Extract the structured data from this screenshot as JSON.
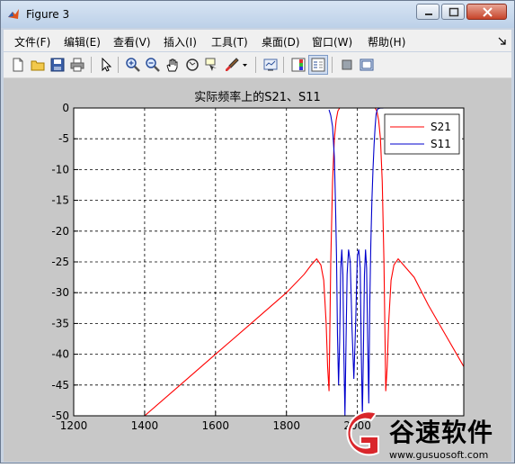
{
  "window": {
    "title": "Figure 3"
  },
  "menu": [
    "文件(F)",
    "编辑(E)",
    "查看(V)",
    "插入(I)",
    "工具(T)",
    "桌面(D)",
    "窗口(W)",
    "帮助(H)"
  ],
  "toolbar": {
    "icons": [
      "new-figure-icon",
      "open-file-icon",
      "save-icon",
      "print-icon",
      "select-arrow-icon",
      "zoom-in-icon",
      "zoom-out-icon",
      "pan-hand-icon",
      "rotate-3d-icon",
      "data-cursor-icon",
      "brush-icon",
      "link-plot-icon",
      "colorbar-icon",
      "legend-icon",
      "hide-plot-tools-icon",
      "show-plot-tools-icon"
    ]
  },
  "chart_data": {
    "type": "line",
    "title": "实际频率上的S21、S11",
    "xlabel": "",
    "ylabel": "",
    "xlim": [
      1200,
      2300
    ],
    "ylim": [
      -50,
      0
    ],
    "xticks": [
      1200,
      1400,
      1600,
      1800,
      2000
    ],
    "yticks": [
      0,
      -5,
      -10,
      -15,
      -20,
      -25,
      -30,
      -35,
      -40,
      -45,
      -50
    ],
    "grid": true,
    "legend_position": "top-right",
    "series": [
      {
        "name": "S21",
        "color": "#ff0000",
        "x": [
          1400,
          1500,
          1600,
          1700,
          1800,
          1850,
          1870,
          1885,
          1897,
          1905,
          1912,
          1916,
          1920,
          1925,
          1930,
          1935,
          1940,
          1945,
          1950,
          2050,
          2055,
          2060,
          2065,
          2070,
          2075,
          2080,
          2084,
          2088,
          2095,
          2103,
          2115,
          2130,
          2160,
          2200,
          2250,
          2300
        ],
        "y": [
          -50,
          -45,
          -40,
          -35,
          -30,
          -27,
          -25.5,
          -24.5,
          -25.5,
          -28,
          -35,
          -42,
          -46,
          -25,
          -12,
          -5,
          -2,
          -0.5,
          0,
          0,
          -0.5,
          -2,
          -5,
          -12,
          -25,
          -46,
          -42,
          -35,
          -28,
          -25.5,
          -24.5,
          -25.5,
          -27.5,
          -32,
          -37,
          -42
        ]
      },
      {
        "name": "S11",
        "color": "#0000cc",
        "x": [
          1920,
          1925,
          1930,
          1935,
          1938,
          1941,
          1944,
          1947,
          1950,
          1953,
          1956,
          1959,
          1962,
          1965,
          1968,
          1971,
          1975,
          1980,
          1985,
          1990,
          1995,
          2000,
          2004,
          2008,
          2011,
          2014,
          2017,
          2020,
          2023,
          2026,
          2029,
          2032,
          2035,
          2038,
          2041,
          2044,
          2047,
          2050,
          2053,
          2056,
          2059,
          2062,
          2065,
          2070,
          2075,
          2080
        ],
        "y": [
          -0.3,
          -1.2,
          -3,
          -8,
          -15,
          -24,
          -37,
          -45,
          -38,
          -26,
          -23,
          -27,
          -40,
          -50,
          -38,
          -27,
          -23,
          -25,
          -36,
          -44,
          -35,
          -24,
          -23,
          -26,
          -40,
          -50,
          -40,
          -27,
          -23,
          -26,
          -38,
          -48,
          -32,
          -22,
          -15,
          -10,
          -6,
          -3,
          -1,
          -0.3,
          -0.1,
          -0.05,
          -0.02,
          -0.01,
          -0.005,
          -0.002
        ]
      }
    ]
  },
  "watermark": {
    "brand": "谷速软件",
    "url": "www.gusuosoft.com"
  }
}
